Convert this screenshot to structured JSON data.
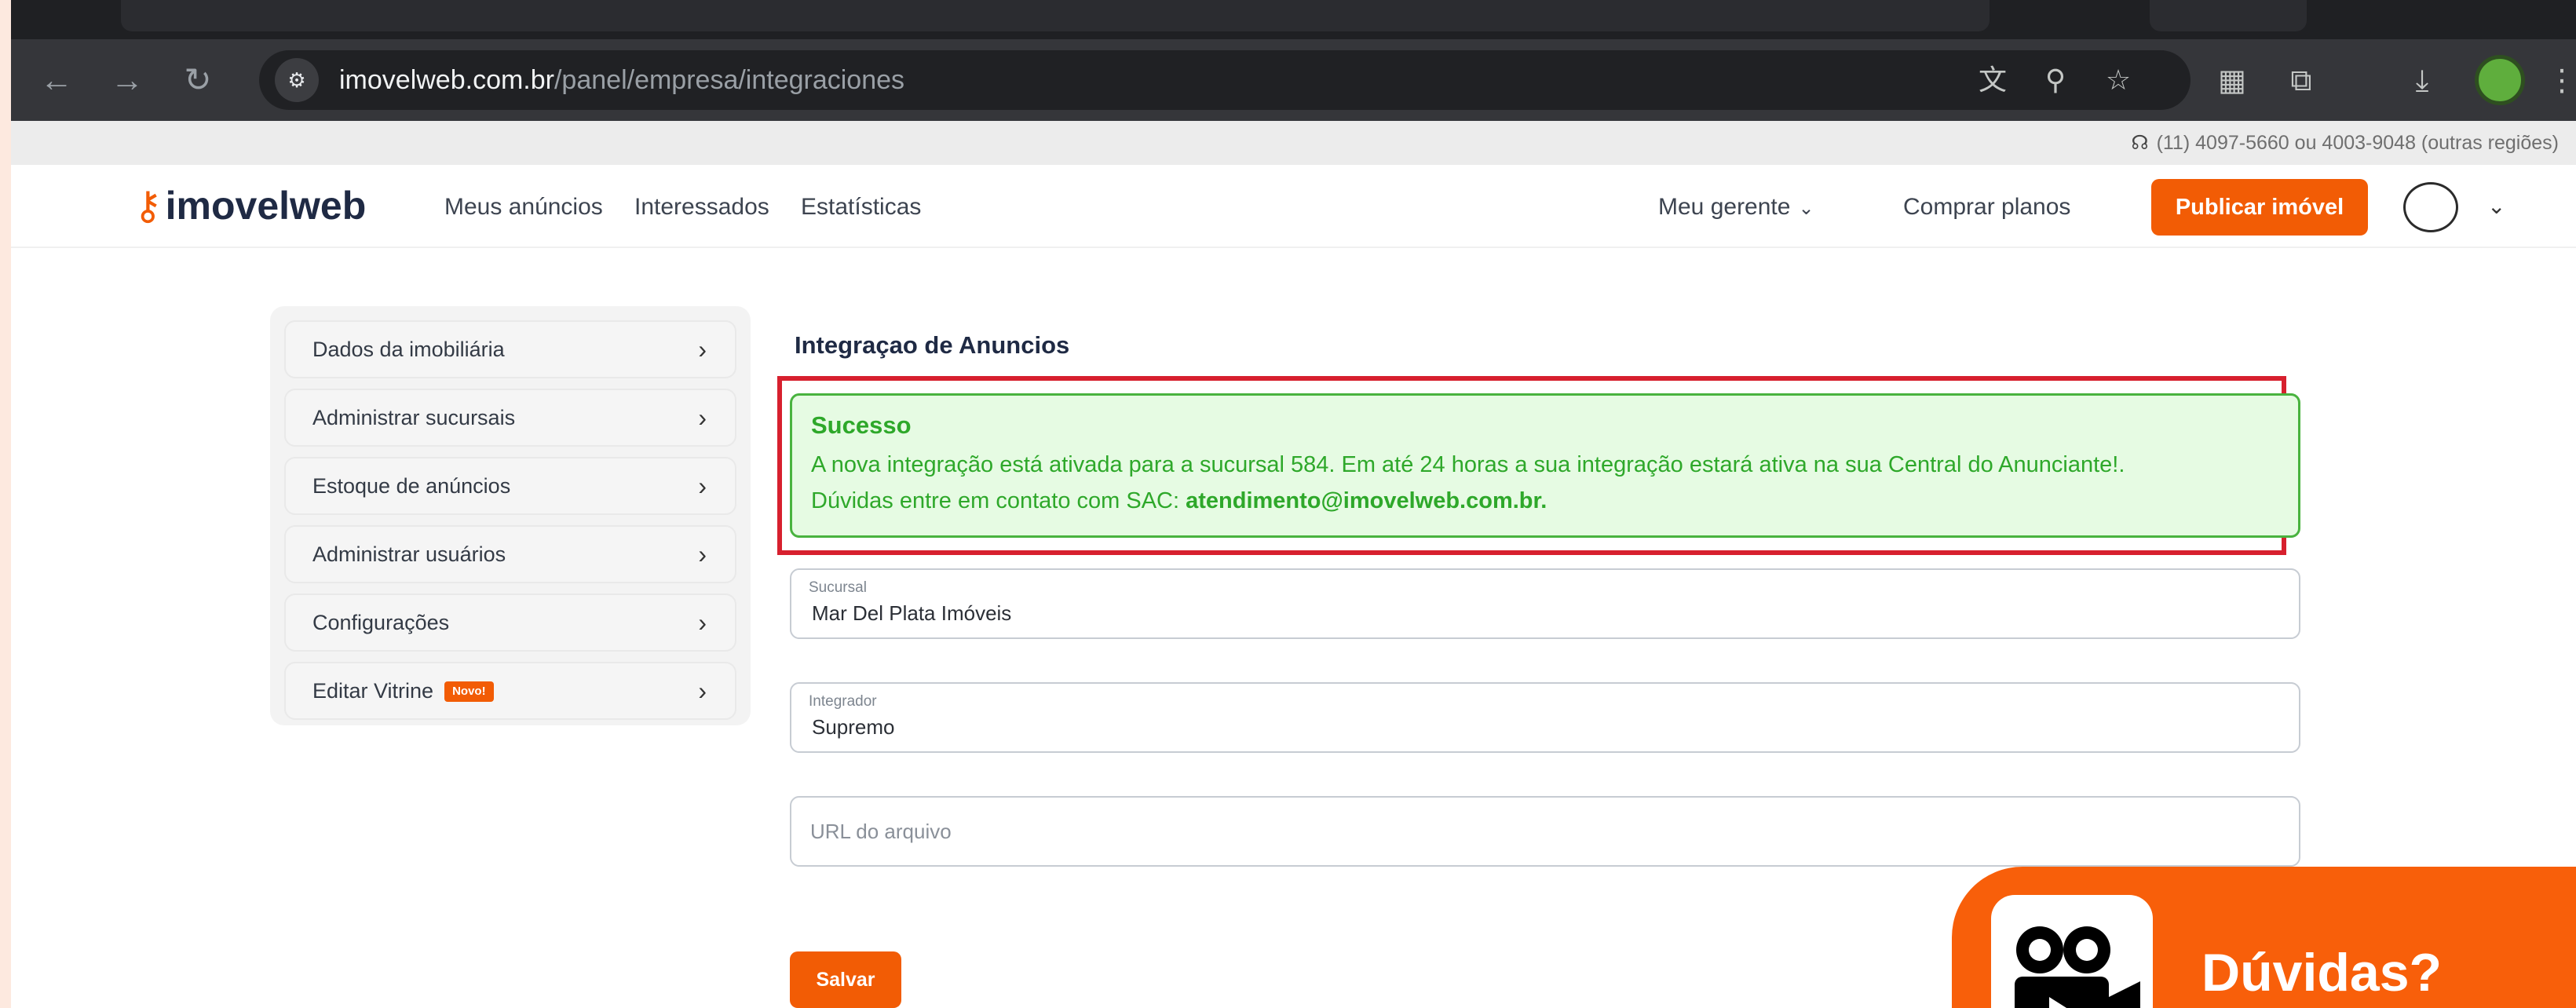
{
  "browser": {
    "url_host": "imovelweb.com.br",
    "url_path": "/panel/empresa/integraciones"
  },
  "topbar": {
    "phone_text": "(11) 4097-5660 ou 4003-9048 (outras regiões)"
  },
  "header": {
    "logo": "imovelweb",
    "nav": [
      "Meus anúncios",
      "Interessados",
      "Estatísticas"
    ],
    "manager_label": "Meu gerente",
    "buy_plans_label": "Comprar planos",
    "publish_label": "Publicar imóvel"
  },
  "sidebar": {
    "items": [
      {
        "label": "Dados da imobiliária"
      },
      {
        "label": "Administrar sucursais"
      },
      {
        "label": "Estoque de anúncios"
      },
      {
        "label": "Administrar usuários"
      },
      {
        "label": "Configurações"
      },
      {
        "label": "Editar Vitrine",
        "badge": "Novo!"
      }
    ]
  },
  "main": {
    "title": "Integraçao de Anuncios",
    "alert": {
      "title": "Sucesso",
      "line1": "A nova integração está ativada para a sucursal 584. Em até 24 horas a sua integração estará ativa na sua Central do Anunciante!.",
      "line2_prefix": "Dúvidas entre em contato com SAC: ",
      "line2_email": "atendimento@imovelweb.com.br."
    },
    "fields": {
      "sucursal": {
        "label": "Sucursal",
        "value": "Mar Del Plata Imóveis"
      },
      "integrador": {
        "label": "Integrador",
        "value": "Supremo"
      },
      "url": {
        "placeholder": "URL do arquivo"
      }
    },
    "save_label": "Salvar"
  },
  "help": {
    "label": "Dúvidas?"
  }
}
